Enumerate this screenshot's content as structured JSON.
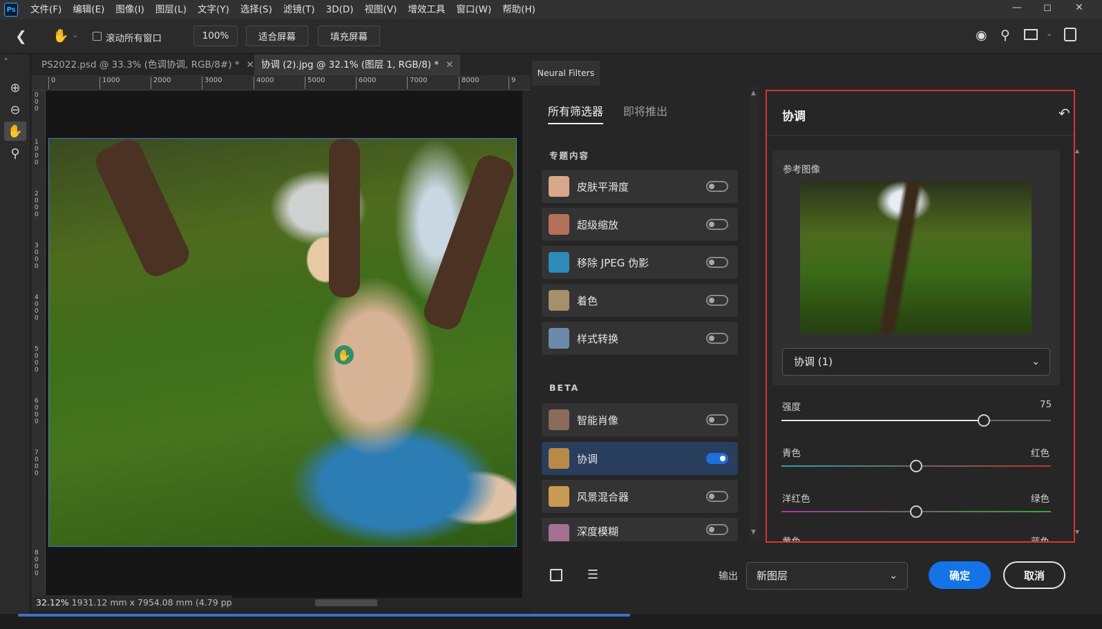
{
  "menubar": {
    "logo": "Ps",
    "items": [
      "文件(F)",
      "编辑(E)",
      "图像(I)",
      "图层(L)",
      "文字(Y)",
      "选择(S)",
      "滤镜(T)",
      "3D(D)",
      "视图(V)",
      "增效工具",
      "窗口(W)",
      "帮助(H)"
    ]
  },
  "options": {
    "scroll_all_label": "滚动所有窗口",
    "zoom_value": "100%",
    "fit_screen": "适合屏幕",
    "fill_screen": "填充屏幕"
  },
  "tabs": [
    {
      "label": "PS2022.psd @ 33.3% (色调协调, RGB/8#) *"
    },
    {
      "label": "协调 (2).jpg @ 32.1% (图层 1, RGB/8) *"
    }
  ],
  "ruler": {
    "h_ticks": [
      "0",
      "1000",
      "2000",
      "3000",
      "4000",
      "5000",
      "6000",
      "7000",
      "8000",
      "9"
    ],
    "v_ticks": [
      "0 0 0",
      "1 0 0 0",
      "2 0 0 0",
      "3 0 0 0",
      "4 0 0 0",
      "5 0 0 0",
      "6 0 0 0",
      "7 0 0 0",
      "8 0 0 0"
    ]
  },
  "status": {
    "zoom": "32.12%",
    "doc_info": "1931.12 mm x 7954.08 mm (4.79 pp"
  },
  "neural_filters": {
    "header": "Neural Filters",
    "tab_all": "所有筛选器",
    "tab_coming": "即将推出",
    "section_featured": "专题内容",
    "section_beta": "BETA",
    "featured": [
      {
        "label": "皮肤平滑度",
        "on": false,
        "color": "#d9a78a"
      },
      {
        "label": "超级缩放",
        "on": false,
        "color": "#b3705a"
      },
      {
        "label": "移除 JPEG 伪影",
        "on": false,
        "color": "#2c8bb8"
      },
      {
        "label": "着色",
        "on": false,
        "color": "#a4916b"
      },
      {
        "label": "样式转换",
        "on": false,
        "color": "#6b89a8"
      }
    ],
    "beta": [
      {
        "label": "智能肖像",
        "on": false,
        "color": "#8a6a58"
      },
      {
        "label": "协调",
        "on": true,
        "color": "#b88a46"
      },
      {
        "label": "风景混合器",
        "on": false,
        "color": "#c89a52"
      },
      {
        "label": "深度模糊",
        "on": false,
        "color": "#a37191"
      }
    ]
  },
  "settings": {
    "title": "协调",
    "ref_label": "参考图像",
    "ref_select": "协调 (1)",
    "strength_label": "强度",
    "strength_value": "75",
    "strength_fraction": 0.75,
    "cyan": "青色",
    "red": "红色",
    "magenta": "洋红色",
    "green": "绿色",
    "yellow_partial": "黄色",
    "blue_partial": "蓝色"
  },
  "footer": {
    "output_label": "输出",
    "output_value": "新图层",
    "ok": "确定",
    "cancel": "取消"
  },
  "colors": {
    "accent": "#1473e6",
    "highlight_border": "#e0322f"
  }
}
